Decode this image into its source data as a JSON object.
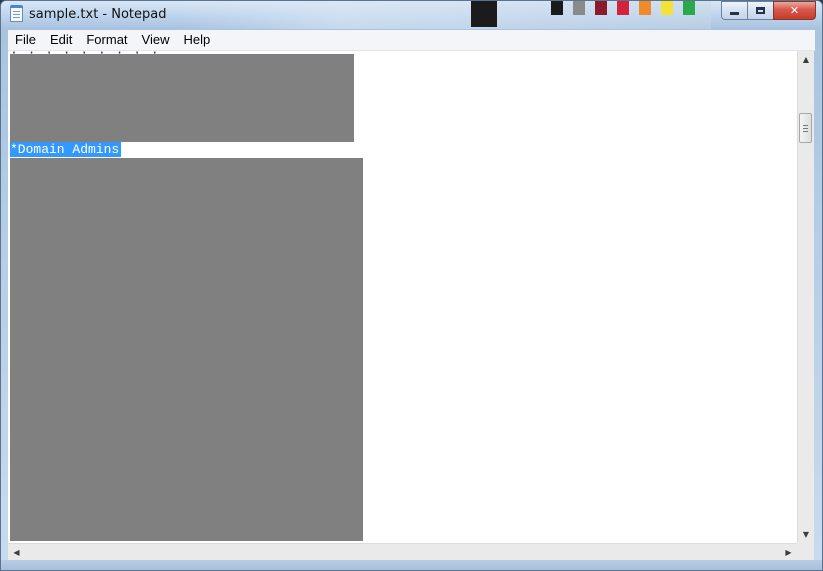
{
  "window": {
    "title": "sample.txt - Notepad",
    "app_icon": "notepad-icon",
    "controls": {
      "minimize": "minimize-icon",
      "maximize": "maximize-icon",
      "close_glyph": "✕"
    }
  },
  "menu": {
    "items": [
      {
        "label": "File"
      },
      {
        "label": "Edit"
      },
      {
        "label": "Format"
      },
      {
        "label": "View"
      },
      {
        "label": "Help"
      }
    ]
  },
  "editor": {
    "visible_line": "*Domain Admins",
    "selection_color": "#3399ff",
    "redaction_color": "#808080"
  },
  "scrollbars": {
    "up_glyph": "▲",
    "down_glyph": "▼",
    "left_glyph": "◀",
    "right_glyph": "▶"
  },
  "colors": {
    "frame": "#bcd3ea",
    "close_button": "#c63c2b"
  }
}
